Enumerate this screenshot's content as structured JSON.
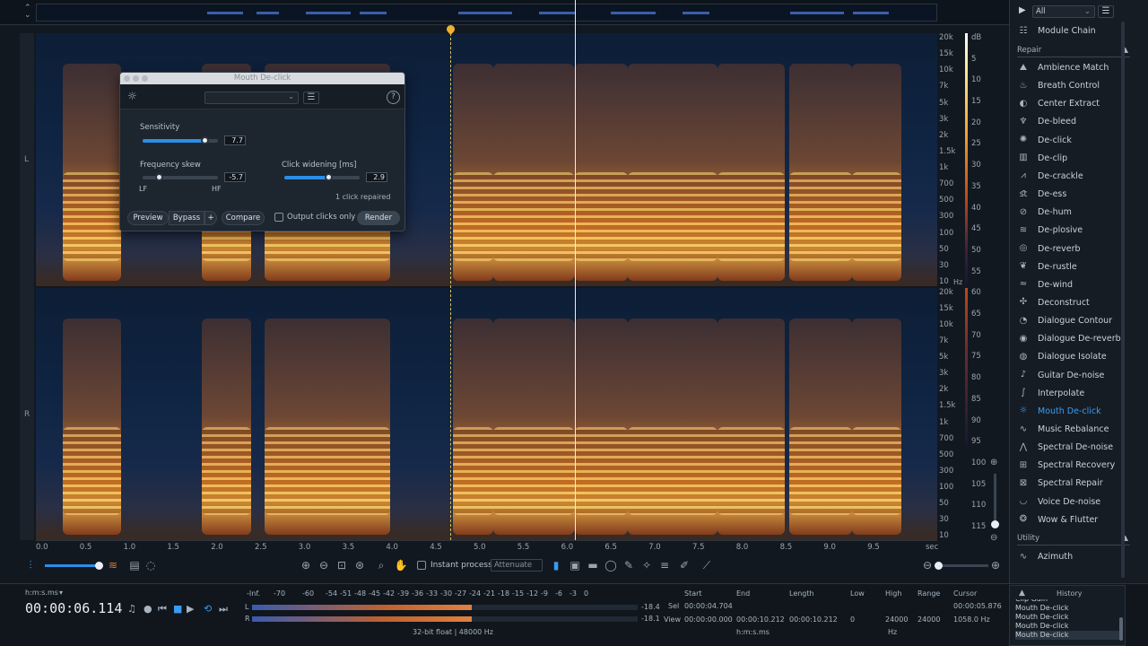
{
  "dialog": {
    "title": "Mouth De-click",
    "sensitivity": {
      "label": "Sensitivity",
      "value": "7.7",
      "level": 0.82
    },
    "frequency_skew": {
      "label": "Frequency skew",
      "value": "-5.7",
      "low": "LF",
      "high": "HF",
      "level": 0.22
    },
    "click_widening": {
      "label": "Click widening [ms]",
      "value": "2.9",
      "level": 0.58
    },
    "status": "1 click repaired",
    "buttons": {
      "preview": "Preview",
      "bypass": "Bypass",
      "plus": "+",
      "compare": "Compare",
      "output_clicks": "Output clicks only",
      "render": "Render"
    },
    "help": "?"
  },
  "channels": {
    "left": "L",
    "right": "R"
  },
  "freq_scale": [
    "20k",
    "15k",
    "10k",
    "7k",
    "5k",
    "3k",
    "2k",
    "1.5k",
    "1k",
    "700",
    "500",
    "300",
    "100",
    "50",
    "30",
    "10"
  ],
  "freq_unit": "Hz",
  "db_scale": [
    "dB",
    "5",
    "10",
    "15",
    "20",
    "25",
    "30",
    "35",
    "40",
    "45",
    "50",
    "55",
    "60",
    "65",
    "70",
    "75",
    "80",
    "85",
    "90",
    "95",
    "100",
    "105",
    "110",
    "115"
  ],
  "time_ruler": [
    "0.0",
    "0.5",
    "1.0",
    "1.5",
    "2.0",
    "2.5",
    "3.0",
    "3.5",
    "4.0",
    "4.5",
    "5.0",
    "5.5",
    "6.0",
    "6.5",
    "7.0",
    "7.5",
    "8.0",
    "8.5",
    "9.0",
    "9.5",
    "sec"
  ],
  "panel": {
    "filter": "All",
    "module_chain": "Module Chain",
    "repair_header": "Repair",
    "modules": [
      "Ambience Match",
      "Breath Control",
      "Center Extract",
      "De-bleed",
      "De-click",
      "De-clip",
      "De-crackle",
      "De-ess",
      "De-hum",
      "De-plosive",
      "De-reverb",
      "De-rustle",
      "De-wind",
      "Deconstruct",
      "Dialogue Contour",
      "Dialogue De-reverb",
      "Dialogue Isolate",
      "Guitar De-noise",
      "Interpolate",
      "Mouth De-click",
      "Music Rebalance",
      "Spectral De-noise",
      "Spectral Recovery",
      "Spectral Repair",
      "Voice De-noise",
      "Wow & Flutter"
    ],
    "active_module": "Mouth De-click",
    "utility_header": "Utility",
    "utility": [
      "Azimuth"
    ]
  },
  "toolbar": {
    "instant_process": "Instant process",
    "mode": "Attenuate"
  },
  "status": {
    "time_format": "h:m:s.ms",
    "time": "00:00:06.114",
    "meter_scale": [
      "-Inf.",
      "-70",
      "-60",
      "-54",
      "-51",
      "-48",
      "-45",
      "-42",
      "-39",
      "-36",
      "-33",
      "-30",
      "-27",
      "-24",
      "-21",
      "-18",
      "-15",
      "-12",
      "-9",
      "-6",
      "-3",
      "0"
    ],
    "meter_l": "L",
    "meter_r": "R",
    "peak_l": "-18.4",
    "peak_r": "-18.1",
    "format": "32-bit float | 48000 Hz",
    "headers": {
      "start": "Start",
      "end": "End",
      "length": "Length",
      "low": "Low",
      "high": "High",
      "range": "Range",
      "cursor": "Cursor"
    },
    "sel_label": "Sel",
    "view_label": "View",
    "sel_start": "00:00:04.704",
    "view_start": "00:00:00.000",
    "view_end": "00:00:10.212",
    "view_length": "00:00:10.212",
    "view_low": "0",
    "view_high": "24000",
    "view_range": "24000",
    "cursor_time": "00:00:05.876",
    "cursor_freq": "1058.0 Hz",
    "time_unit": "h:m:s.ms",
    "freq_unit": "Hz"
  },
  "history": {
    "title": "History",
    "items": [
      "Clip Gain",
      "Mouth De-click",
      "Mouth De-click",
      "Mouth De-click",
      "Mouth De-click"
    ]
  }
}
